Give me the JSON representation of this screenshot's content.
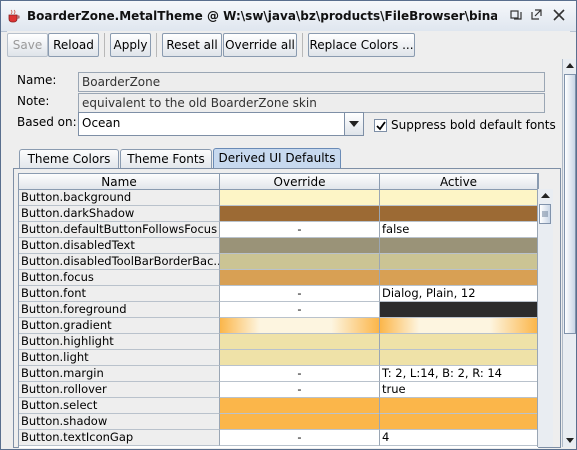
{
  "window": {
    "title": "BoarderZone.MetalTheme @ W:\\sw\\java\\bz\\products\\FileBrowser\\binary\\conf\\the..."
  },
  "toolbar": {
    "save_label": "Save",
    "reload_label": "Reload",
    "apply_label": "Apply",
    "reset_all_label": "Reset all",
    "override_all_label": "Override all",
    "replace_colors_label": "Replace Colors ..."
  },
  "form": {
    "name_label": "Name:",
    "name_value": "BoarderZone",
    "note_label": "Note:",
    "note_value": "equivalent to the old BoarderZone skin",
    "based_on_label": "Based on:",
    "based_on_value": "Ocean",
    "suppress_bold_label": "Suppress bold default fonts",
    "suppress_bold_checked": true
  },
  "tabs": [
    {
      "label": "Theme Colors",
      "active": false
    },
    {
      "label": "Theme Fonts",
      "active": false
    },
    {
      "label": "Derived UI Defaults",
      "active": true
    }
  ],
  "table": {
    "columns": [
      "Name",
      "Override",
      "Active"
    ],
    "rows": [
      {
        "name": "Button.background",
        "override": "",
        "active": "",
        "ov_color": "#fdf5c6",
        "act_color": "#fdf5c6"
      },
      {
        "name": "Button.darkShadow",
        "override": "",
        "active": "",
        "ov_color": "#9c6a34",
        "act_color": "#9c6a34"
      },
      {
        "name": "Button.defaultButtonFollowsFocus",
        "override": "-",
        "active": "false",
        "ov_color": "",
        "act_color": ""
      },
      {
        "name": "Button.disabledText",
        "override": "",
        "active": "",
        "ov_color": "#9a9378",
        "act_color": "#9a9378"
      },
      {
        "name": "Button.disabledToolBarBorderBac...",
        "override": "",
        "active": "",
        "ov_color": "#cbc494",
        "act_color": "#cbc494"
      },
      {
        "name": "Button.focus",
        "override": "",
        "active": "",
        "ov_color": "#d8a054",
        "act_color": "#d8a054"
      },
      {
        "name": "Button.font",
        "override": "-",
        "active": "Dialog, Plain, 12",
        "ov_color": "",
        "act_color": ""
      },
      {
        "name": "Button.foreground",
        "override": "-",
        "active": "",
        "ov_color": "",
        "act_color": "#2c2c2c"
      },
      {
        "name": "Button.gradient",
        "override": "",
        "active": "",
        "ov_color": "gradient",
        "act_color": "gradient"
      },
      {
        "name": "Button.highlight",
        "override": "",
        "active": "",
        "ov_color": "#efe2a8",
        "act_color": "#efe2a8"
      },
      {
        "name": "Button.light",
        "override": "",
        "active": "",
        "ov_color": "#efe2a8",
        "act_color": "#efe2a8"
      },
      {
        "name": "Button.margin",
        "override": "-",
        "active": "T: 2, L:14, B: 2, R: 14",
        "ov_color": "",
        "act_color": ""
      },
      {
        "name": "Button.rollover",
        "override": "-",
        "active": "true",
        "ov_color": "",
        "act_color": ""
      },
      {
        "name": "Button.select",
        "override": "",
        "active": "",
        "ov_color": "#fbb64a",
        "act_color": "#fbb64a"
      },
      {
        "name": "Button.shadow",
        "override": "",
        "active": "",
        "ov_color": "#fbb64a",
        "act_color": "#fbb64a"
      },
      {
        "name": "Button.textIconGap",
        "override": "-",
        "active": "4",
        "ov_color": "",
        "act_color": ""
      }
    ]
  },
  "colors": {
    "accent": "#c7d9ef",
    "border": "#8a9bb0"
  }
}
